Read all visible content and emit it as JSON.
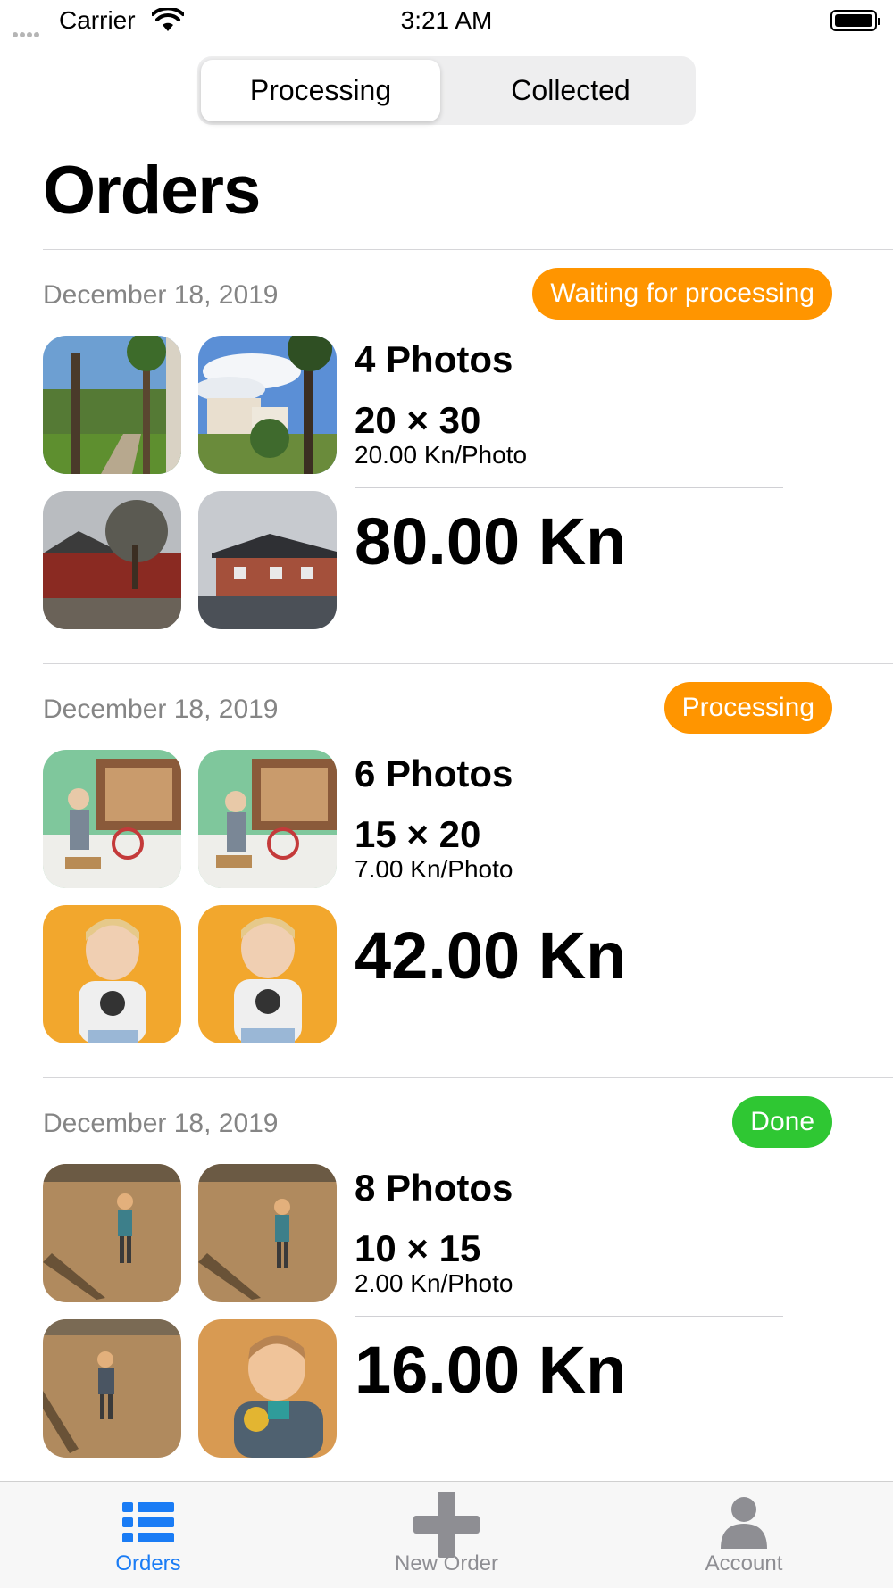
{
  "status_bar": {
    "carrier": "Carrier",
    "time": "3:21 AM"
  },
  "segmented": {
    "tabs": [
      "Processing",
      "Collected"
    ],
    "active": "Processing"
  },
  "title": "Orders",
  "orders": [
    {
      "date": "December 18, 2019",
      "status": "Waiting for processing",
      "status_color": "#FF9500",
      "photos": "4 Photos",
      "size": "20 × 30",
      "price_per_photo": "20.00 Kn/Photo",
      "total": "80.00 Kn",
      "thumbnails": [
        "palm-garden-photo",
        "palm-house-photo",
        "red-house-photo",
        "brick-house-photo"
      ]
    },
    {
      "date": "December 18, 2019",
      "status": "Processing",
      "status_color": "#FF9500",
      "photos": "6 Photos",
      "size": "15 × 20",
      "price_per_photo": "7.00 Kn/Photo",
      "total": "42.00 Kn",
      "thumbnails": [
        "toddler-playroom-photo",
        "toddler-playroom-photo",
        "toddler-portrait-photo",
        "toddler-portrait-photo"
      ]
    },
    {
      "date": "December 18, 2019",
      "status": "Done",
      "status_color": "#2FC733",
      "photos": "8 Photos",
      "size": "10 × 15",
      "price_per_photo": "2.00 Kn/Photo",
      "total": "16.00 Kn",
      "thumbnails": [
        "beach-toddler-photo",
        "beach-toddler-photo",
        "beach-walk-photo",
        "child-holding-orange-photo"
      ]
    }
  ],
  "tab_bar": {
    "items": [
      {
        "label": "Orders",
        "icon": "list-icon",
        "active": true
      },
      {
        "label": "New Order",
        "icon": "plus-icon",
        "active": false
      },
      {
        "label": "Account",
        "icon": "person-icon",
        "active": false
      }
    ],
    "active_color": "#1A7CF5",
    "inactive_color": "#8E8E93"
  }
}
